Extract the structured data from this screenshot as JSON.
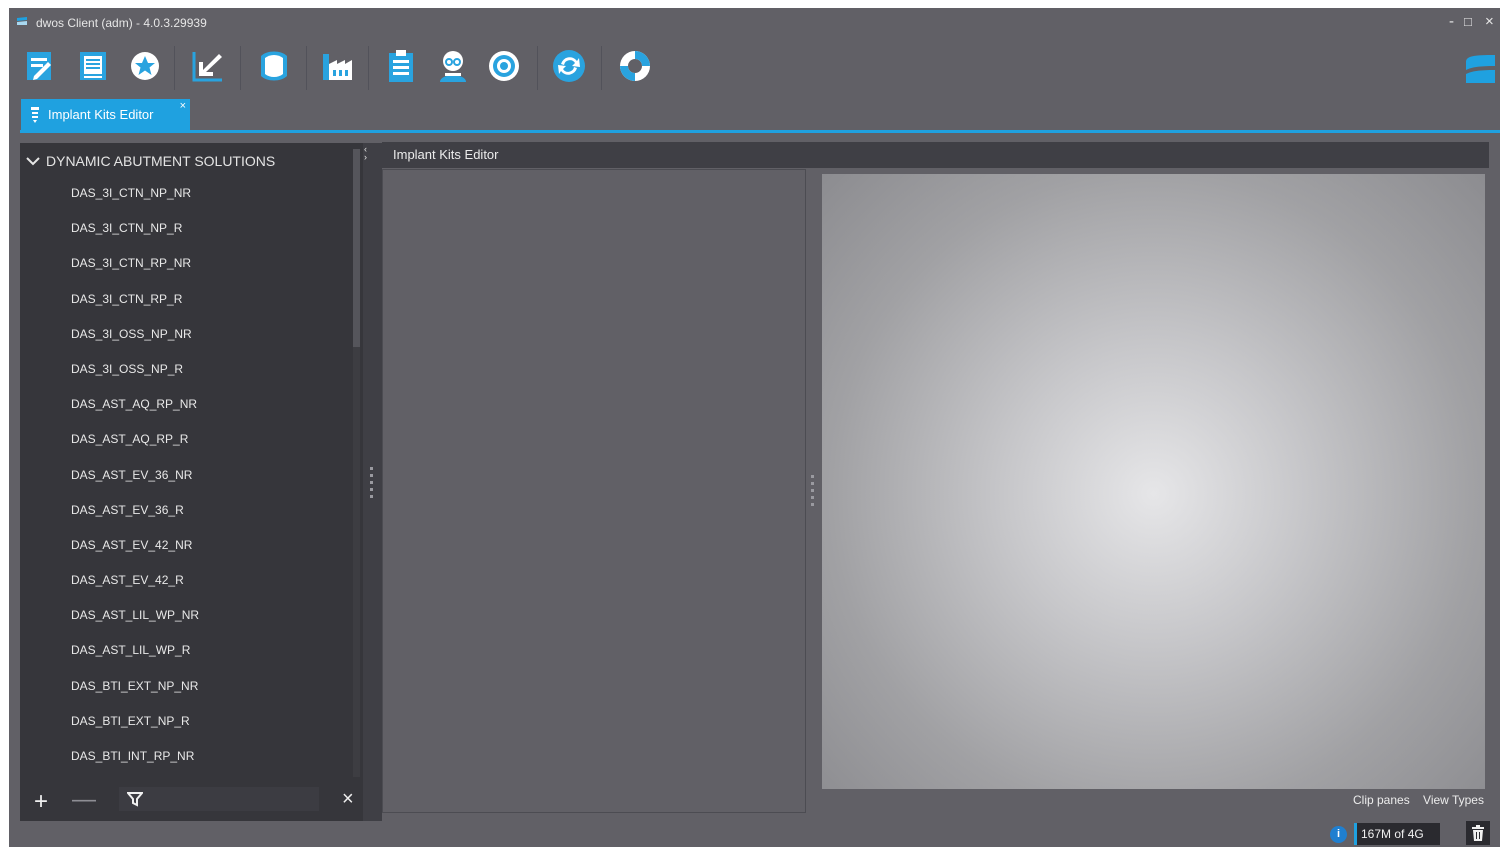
{
  "window": {
    "title": "dwos Client (adm) - 4.0.3.29939",
    "minimize": "-",
    "maximize": "□",
    "close": "×"
  },
  "toolbar": {
    "buttons": [
      {
        "icon": "document-edit-icon"
      },
      {
        "icon": "form-list-icon"
      },
      {
        "icon": "star-icon"
      },
      {
        "icon": "import-arrow-icon"
      },
      {
        "icon": "dental-arch-icon"
      },
      {
        "icon": "factory-icon"
      },
      {
        "icon": "clipboard-icon"
      },
      {
        "icon": "user-glasses-icon"
      },
      {
        "icon": "settings-gear-icon"
      },
      {
        "icon": "refresh-icon"
      },
      {
        "icon": "help-lifebuoy-icon"
      }
    ],
    "brand_icon": "dwos-logo-icon",
    "accent": "#1fa1e0"
  },
  "tab": {
    "label": "Implant Kits Editor",
    "close": "×"
  },
  "tree": {
    "header": "DYNAMIC ABUTMENT SOLUTIONS",
    "items": [
      "DAS_3I_CTN_NP_NR",
      "DAS_3I_CTN_NP_R",
      "DAS_3I_CTN_RP_NR",
      "DAS_3I_CTN_RP_R",
      "DAS_3I_OSS_NP_NR",
      "DAS_3I_OSS_NP_R",
      "DAS_AST_AQ_RP_NR",
      "DAS_AST_AQ_RP_R",
      "DAS_AST_EV_36_NR",
      "DAS_AST_EV_36_R",
      "DAS_AST_EV_42_NR",
      "DAS_AST_EV_42_R",
      "DAS_AST_LIL_WP_NR",
      "DAS_AST_LIL_WP_R",
      "DAS_BTI_EXT_NP_NR",
      "DAS_BTI_EXT_NP_R",
      "DAS_BTI_INT_RP_NR"
    ]
  },
  "bottom": {
    "add": "+",
    "remove": "—",
    "clear": "×"
  },
  "editor": {
    "header": "Implant Kits Editor",
    "clip_panes": "Clip panes",
    "view_types": "View Types"
  },
  "status": {
    "info": "i",
    "memory": "167M of 4G"
  }
}
